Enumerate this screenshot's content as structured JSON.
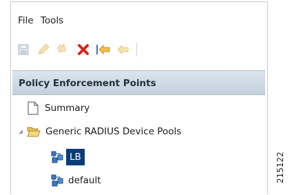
{
  "menu": {
    "file": "File",
    "tools": "Tools"
  },
  "toolbar": {
    "icons": [
      "save-icon",
      "edit-icon",
      "refresh-icon",
      "delete-icon",
      "move-left-icon",
      "move-right-icon"
    ],
    "colors": {
      "delete": "#d8241d",
      "arrow": "#f2c14e",
      "disabled": "#e8d7a6"
    }
  },
  "panel": {
    "title": "Policy Enforcement Points"
  },
  "tree": {
    "summary": "Summary",
    "group": "Generic RADIUS Device Pools",
    "children": [
      "LB",
      "default"
    ],
    "selected": "LB"
  },
  "watermark": "215122",
  "colors": {
    "selection": "#0a3c78",
    "header": "#c3d0dc"
  }
}
